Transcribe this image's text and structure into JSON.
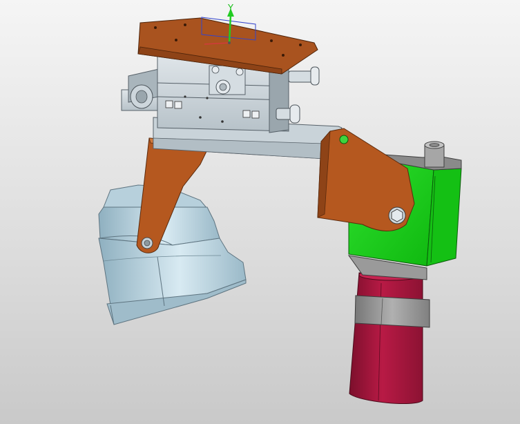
{
  "viewport": {
    "background_top": "#f5f5f5",
    "background_bottom": "#c9c9c9"
  },
  "triad": {
    "y_axis_label": "Y",
    "y_axis_color": "#22cc22",
    "x_axis_color": "#d23b3b",
    "plane_color": "#3344cc"
  },
  "colors": {
    "mounting_plate": "#a9531f",
    "slide_block": "#c7d0d6",
    "bracket": "#b5581f",
    "nozzle": "#aac8d6",
    "motor_housing": "#19d219",
    "motor_cap": "#8a8a8a",
    "cylinder": "#a0143a",
    "cylinder_band": "#8f8f8f"
  },
  "parts": [
    "mounting-plate",
    "xy-slide-stage",
    "support-arm",
    "cone-nozzle",
    "pivot-bracket",
    "gear-motor",
    "drive-cylinder"
  ]
}
